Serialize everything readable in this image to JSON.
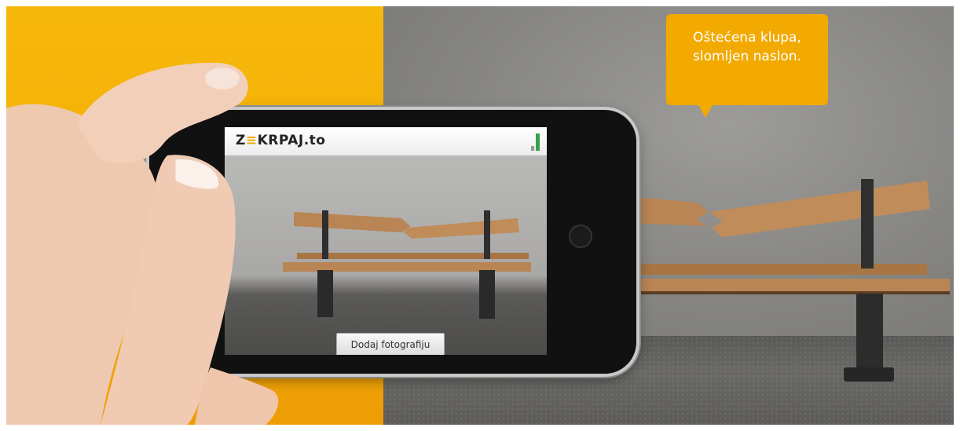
{
  "speech_bubble": {
    "line1": "Oštećena klupa,",
    "line2": "slomljen naslon."
  },
  "app": {
    "logo_prefix": "Z",
    "logo_accent": "≡",
    "logo_rest": "KRPAJ.to",
    "add_photo_button_label": "Dodaj fotografiju"
  },
  "colors": {
    "brand_yellow": "#f2a900",
    "background_yellow": "#f6b80a",
    "wall_gray": "#8a8986",
    "bench_wood": "#b98554"
  },
  "icons": [
    "signal-icon",
    "camera-lens-icon",
    "home-button-icon"
  ]
}
